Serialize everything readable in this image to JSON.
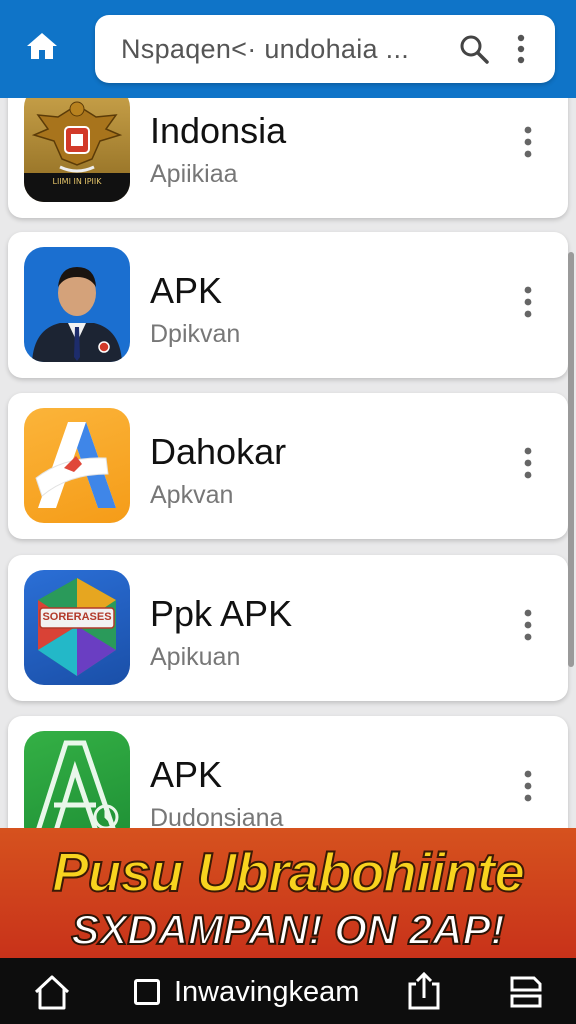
{
  "search": {
    "text": "Nspaqen<· undohaia ...",
    "icon": "search-icon"
  },
  "apps": [
    {
      "name": "Indonsia",
      "sub": "Apiikiaa",
      "icon": "garuda-emblem-icon",
      "icon_caption": "LIIMI IN IPIIK"
    },
    {
      "name": "APK",
      "sub": "Dpikvan",
      "icon": "portrait-icon"
    },
    {
      "name": "Dahokar",
      "sub": "Apkvan",
      "icon": "letter-a-icon"
    },
    {
      "name": "Ppk APK",
      "sub": "Apikuan",
      "icon": "badge-icon",
      "icon_caption": "SORERASES"
    },
    {
      "name": "APK",
      "sub": "Dudonsiana",
      "icon": "green-a-icon"
    }
  ],
  "banner": {
    "line1": "Pusu Ubrabohiinte",
    "line2": "SXDAMPAN! ON 2AP!"
  },
  "nav": {
    "tab_label": "Inwavingkeam"
  },
  "colors": {
    "topbar": "#0f74c8",
    "banner": "#d6521e",
    "banner_text": "#f8d31f"
  }
}
